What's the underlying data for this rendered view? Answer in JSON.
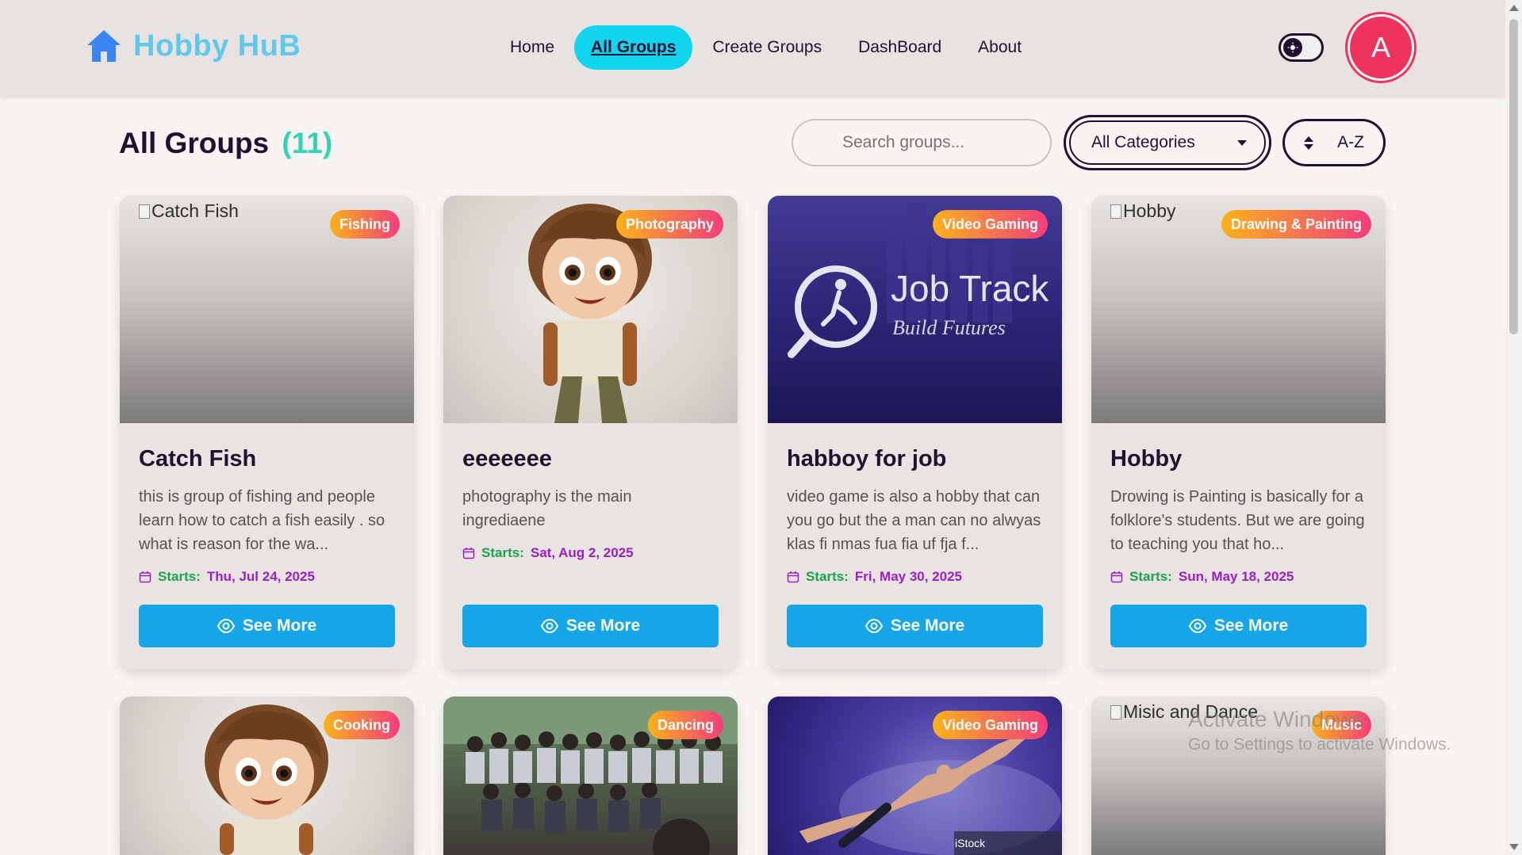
{
  "navbar": {
    "brand": "Hobby HuB",
    "links": [
      "Home",
      "All Groups",
      "Create Groups",
      "DashBoard",
      "About"
    ],
    "active_link": "All Groups",
    "avatar_letter": "A"
  },
  "header": {
    "title": "All Groups",
    "count": "(11)",
    "search_placeholder": "Search groups...",
    "category_selected": "All Categories",
    "sort_label": "A-Z"
  },
  "cards": [
    {
      "title": "Catch Fish",
      "badge": "Fishing",
      "image_alt": "Catch Fish",
      "description": "this is group of fishing and people learn how to catch a fish easily . so what is reason for the wa...",
      "start_label": "Starts:",
      "start_date": "Thu, Jul 24, 2025",
      "button": "See More"
    },
    {
      "title": "eeeeeee",
      "badge": "Photography",
      "image_alt": "",
      "description": "photography is the main ingrediaene",
      "start_label": "Starts:",
      "start_date": "Sat, Aug 2, 2025",
      "button": "See More"
    },
    {
      "title": "habboy for job",
      "badge": "Video Gaming",
      "image_alt": "",
      "image_text_main": "Job Track",
      "image_text_sub": "Build Futures",
      "description": "video game is also a hobby that can you go but the a man can no alwyas klas fi nmas fua fia uf fja f...",
      "start_label": "Starts:",
      "start_date": "Fri, May 30, 2025",
      "button": "See More"
    },
    {
      "title": "Hobby",
      "badge": "Drawing & Painting",
      "image_alt": "Hobby",
      "description": "Drowing is Painting is basically for a folklore's students. But we are going to teaching you that ho...",
      "start_label": "Starts:",
      "start_date": "Sun, May 18, 2025",
      "button": "See More"
    },
    {
      "badge": "Cooking"
    },
    {
      "badge": "Dancing"
    },
    {
      "badge": "Video Gaming",
      "image_watermark": "iStock"
    },
    {
      "badge": "Music",
      "image_alt": "Misic and Dance"
    }
  ],
  "watermark": {
    "line1": "Activate Windows",
    "line2": "Go to Settings to activate Windows."
  },
  "colors": {
    "accent_cyan": "#11d4ee",
    "brand_blue": "#5ec8ef",
    "button_blue": "#15a6e9",
    "avatar_red": "#f0335d",
    "count_teal": "#33d1b6",
    "date_purple": "#9a1fc7",
    "starts_green": "#1aa44b"
  },
  "icons": [
    "home-icon",
    "theme-toggle-icon",
    "search-icon",
    "chevron-down-icon",
    "sort-icon",
    "calendar-icon",
    "eye-icon"
  ]
}
